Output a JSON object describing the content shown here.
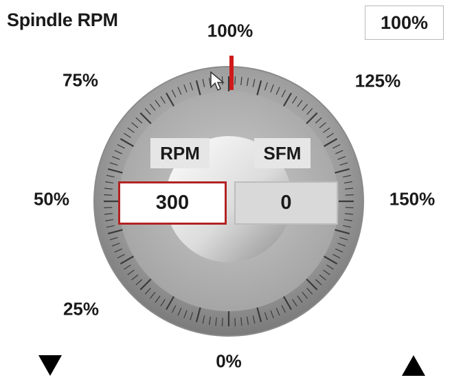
{
  "title": "Spindle RPM",
  "override_value": "100%",
  "dial": {
    "labels": {
      "p0": "0%",
      "p25": "25%",
      "p50": "50%",
      "p75": "75%",
      "p100": "100%",
      "p125": "125%",
      "p150": "150%"
    },
    "current_percent": 100,
    "indicator_color": "#d01a1a"
  },
  "fields": {
    "rpm_label": "RPM",
    "rpm_value": "300",
    "sfm_label": "SFM",
    "sfm_value": "0"
  },
  "controls": {
    "decrease_icon": "triangle-down-icon",
    "increase_icon": "triangle-up-icon"
  },
  "colors": {
    "rpm_border": "#b22222",
    "dial_face": "#a8a8a8"
  }
}
